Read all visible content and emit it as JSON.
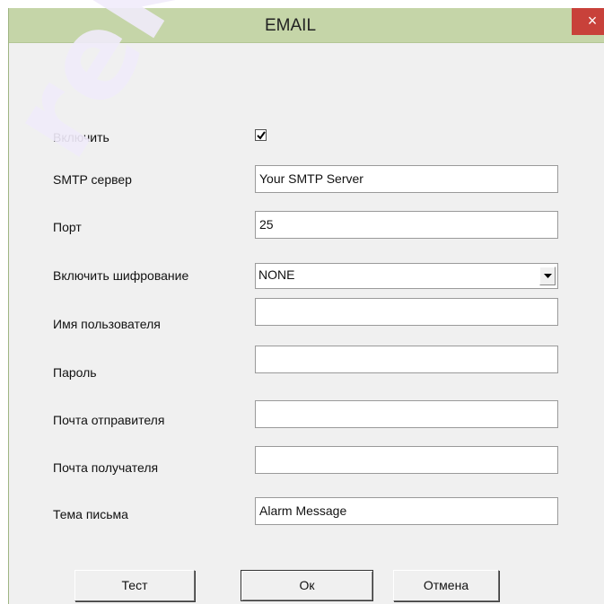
{
  "watermark": "rek",
  "dialog": {
    "title": "EMAIL",
    "close_glyph": "×"
  },
  "form": {
    "enable_label": "Включить",
    "enable_checked": true,
    "smtp_label": "SMTP сервер",
    "smtp_value": "Your SMTP Server",
    "port_label": "Порт",
    "port_value": "25",
    "encryption_label": "Включить шифрование",
    "encryption_value": "NONE",
    "username_label": "Имя пользователя",
    "username_value": "",
    "password_label": "Пароль",
    "password_value": "",
    "sender_label": "Почта отправителя",
    "sender_value": "",
    "recipient_label": "Почта получателя",
    "recipient_value": "",
    "subject_label": "Тема письма",
    "subject_value": "Alarm Message"
  },
  "buttons": {
    "test": "Тест",
    "ok": "Ок",
    "cancel": "Отмена"
  },
  "colors": {
    "titlebar": "#c5d5a8",
    "close": "#c8413a",
    "dialog_bg": "#f0f0f0"
  },
  "icons": {
    "close": "close-icon",
    "dropdown": "chevron-down-icon",
    "check": "check-icon"
  }
}
